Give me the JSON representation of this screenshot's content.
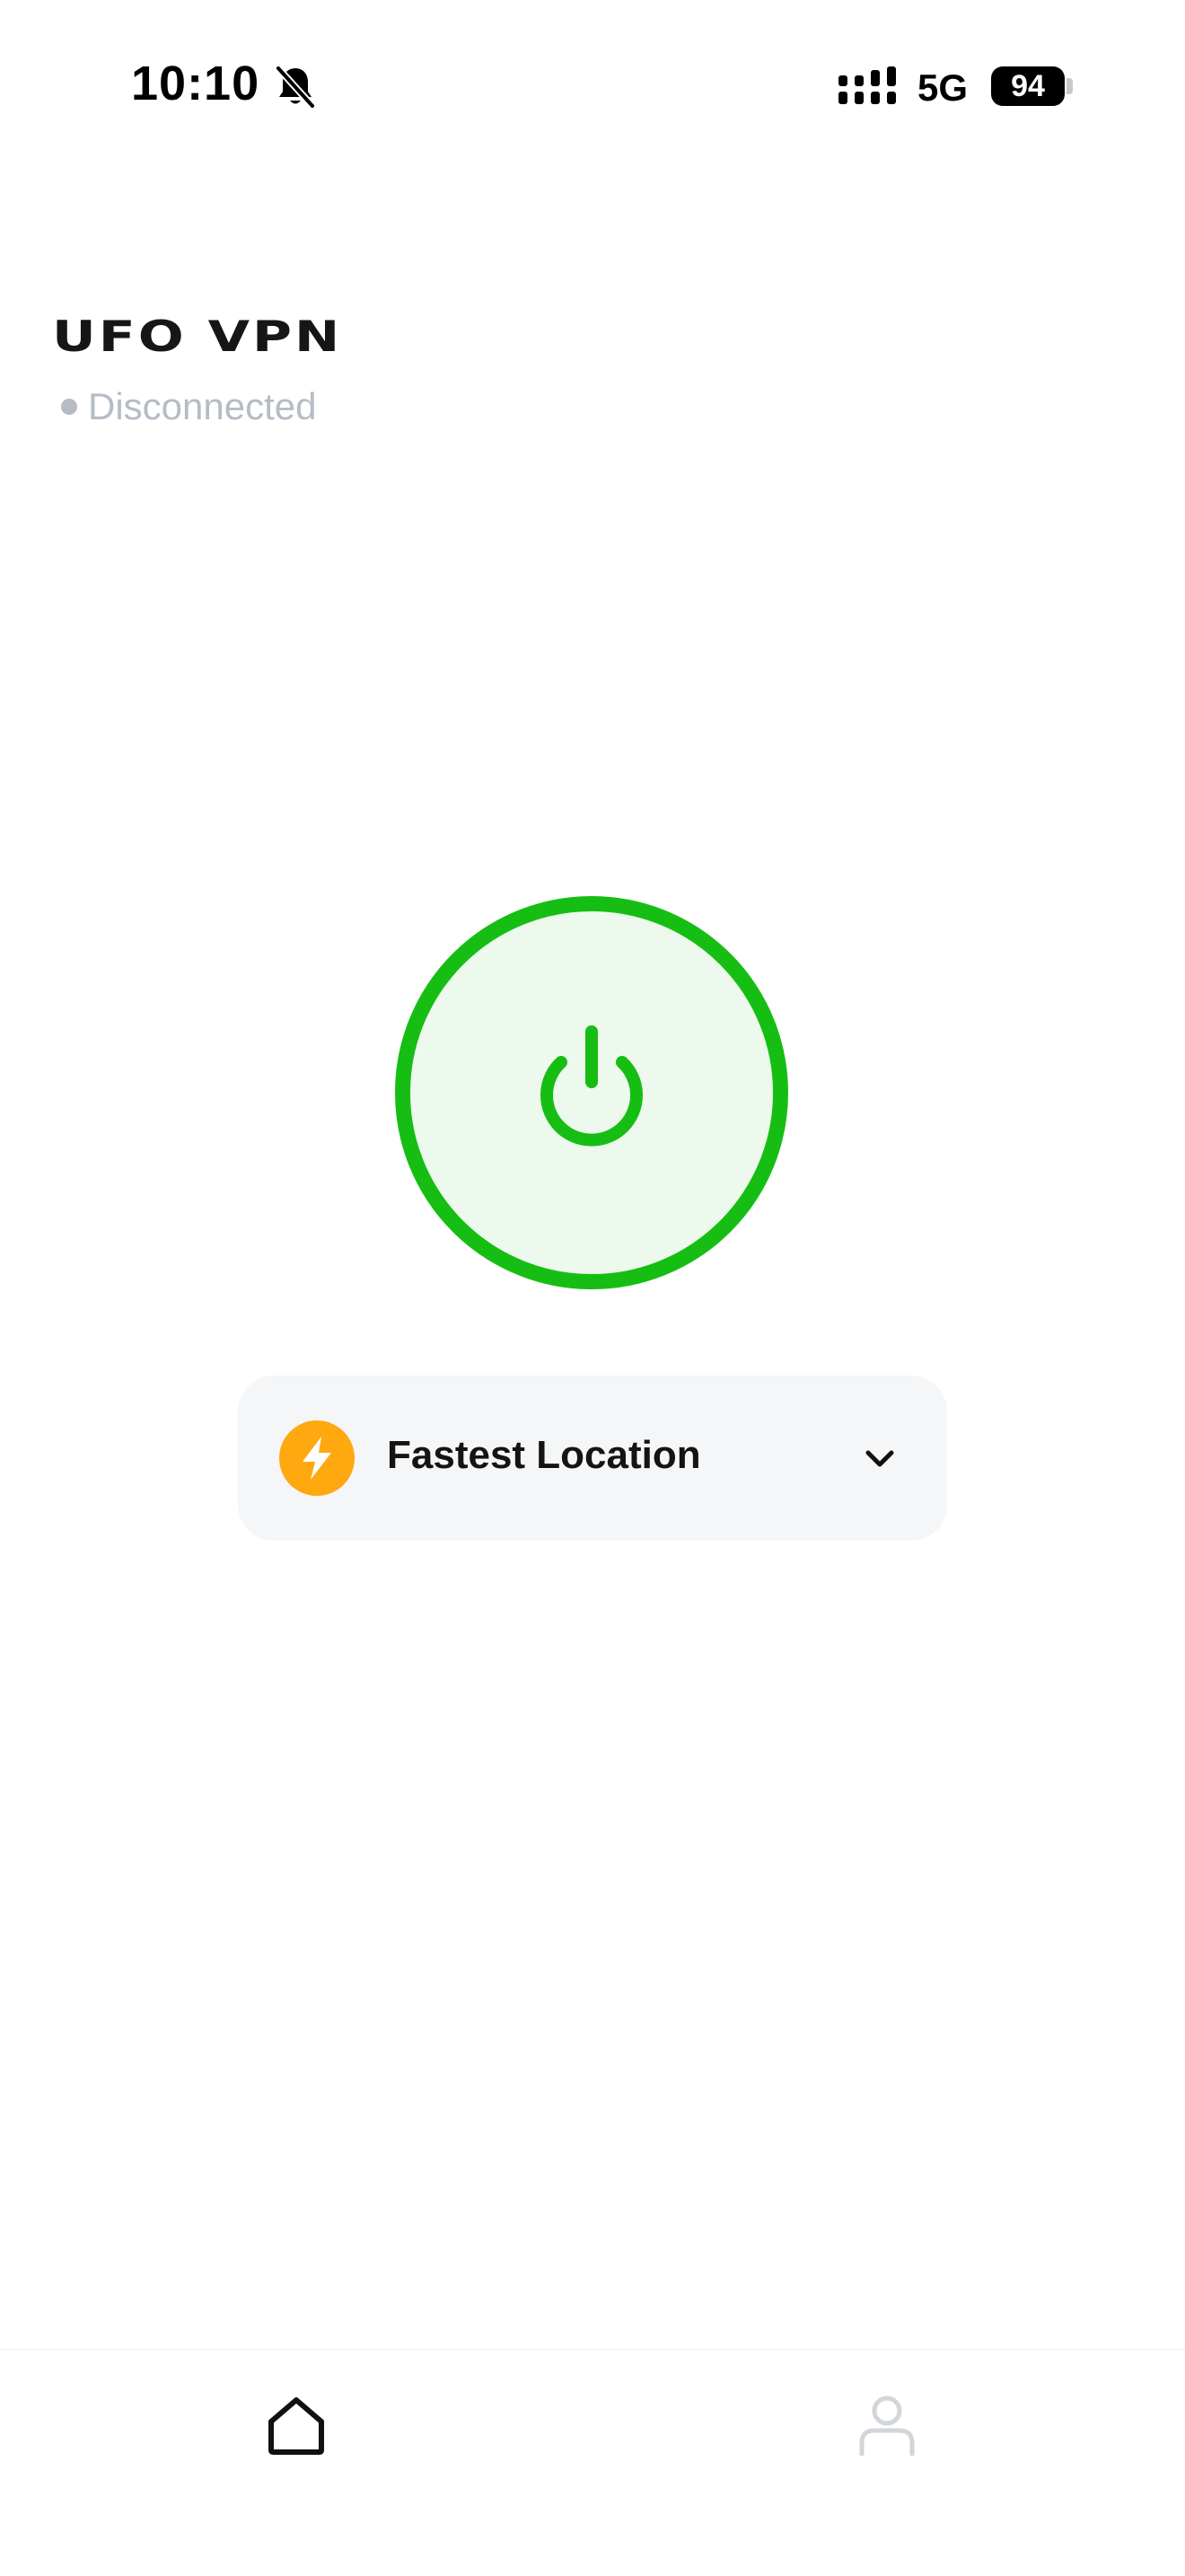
{
  "status_bar": {
    "time": "10:10",
    "network": "5G",
    "battery": "94",
    "icons": [
      "bell-off-icon",
      "signal-icon",
      "battery-icon"
    ]
  },
  "header": {
    "app_name": "UFO VPN",
    "connection_status": "Disconnected"
  },
  "power_button": {
    "icon": "power-icon",
    "color": "#16be14",
    "fill_color": "#eef9ee"
  },
  "location": {
    "label": "Fastest Location",
    "icon": "lightning-bolt-icon",
    "icon_color": "#ffa80f",
    "dropdown_icon": "chevron-down-icon"
  },
  "tab_bar": {
    "tabs": [
      {
        "name": "home",
        "icon": "home-icon",
        "active": true
      },
      {
        "name": "profile",
        "icon": "person-icon",
        "active": false
      }
    ]
  },
  "colors": {
    "accent_green": "#16be14",
    "status_gray": "#b5bcc6",
    "card_background": "#f5f6f8",
    "bolt_orange": "#ffa80f"
  }
}
